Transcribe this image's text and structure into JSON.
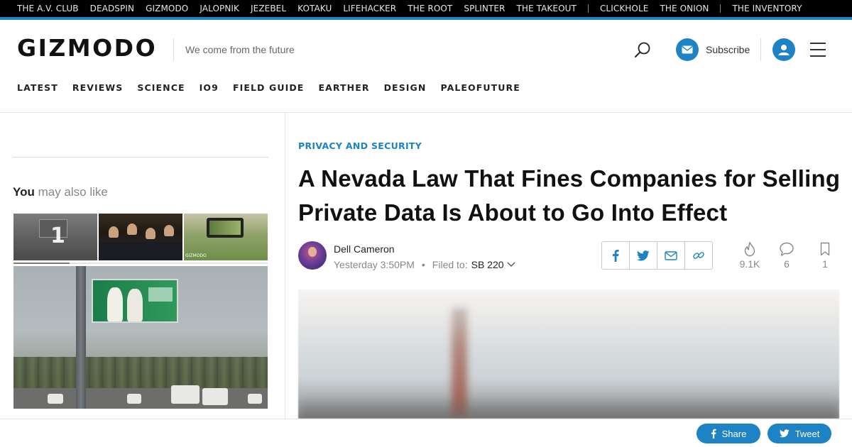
{
  "network_bar": {
    "group1": [
      "THE A.V. CLUB",
      "DEADSPIN",
      "GIZMODO",
      "JALOPNIK",
      "JEZEBEL",
      "KOTAKU",
      "LIFEHACKER",
      "THE ROOT",
      "SPLINTER",
      "THE TAKEOUT"
    ],
    "group2": [
      "CLICKHOLE",
      "THE ONION"
    ],
    "group3": [
      "THE INVENTORY"
    ]
  },
  "header": {
    "logo": "GIZMODO",
    "tagline": "We come from the future",
    "subscribe_label": "Subscribe",
    "icons": [
      "search-icon",
      "envelope-icon",
      "user-icon",
      "hamburger-menu-icon"
    ]
  },
  "main_nav": [
    "LATEST",
    "REVIEWS",
    "SCIENCE",
    "IO9",
    "FIELD GUIDE",
    "EARTHER",
    "DESIGN",
    "PALEOFUTURE"
  ],
  "sidebar": {
    "heading_bold": "You",
    "heading_rest": " may also like",
    "first_thumb_number": "1",
    "third_thumb_caption": "GIZMODO",
    "carousel_progress": 0.22
  },
  "article": {
    "category": "PRIVACY AND SECURITY",
    "headline": "A Nevada Law That Fines Companies for Selling Private Data Is About to Go Into Effect",
    "author": "Dell Cameron",
    "timestamp": "Yesterday 3:50PM",
    "dot": "•",
    "filed_to_label": "Filed to:",
    "filed_to_tag": "SB 220",
    "share_icons": [
      "facebook-icon",
      "twitter-icon",
      "email-icon",
      "link-icon"
    ],
    "stats": {
      "views": "9.1K",
      "comments": "6",
      "saves": "1"
    }
  },
  "bottom_bar": {
    "share_label": "Share",
    "tweet_label": "Tweet"
  },
  "colors": {
    "accent": "#1d83c4",
    "network_bar_bg": "#000000"
  }
}
